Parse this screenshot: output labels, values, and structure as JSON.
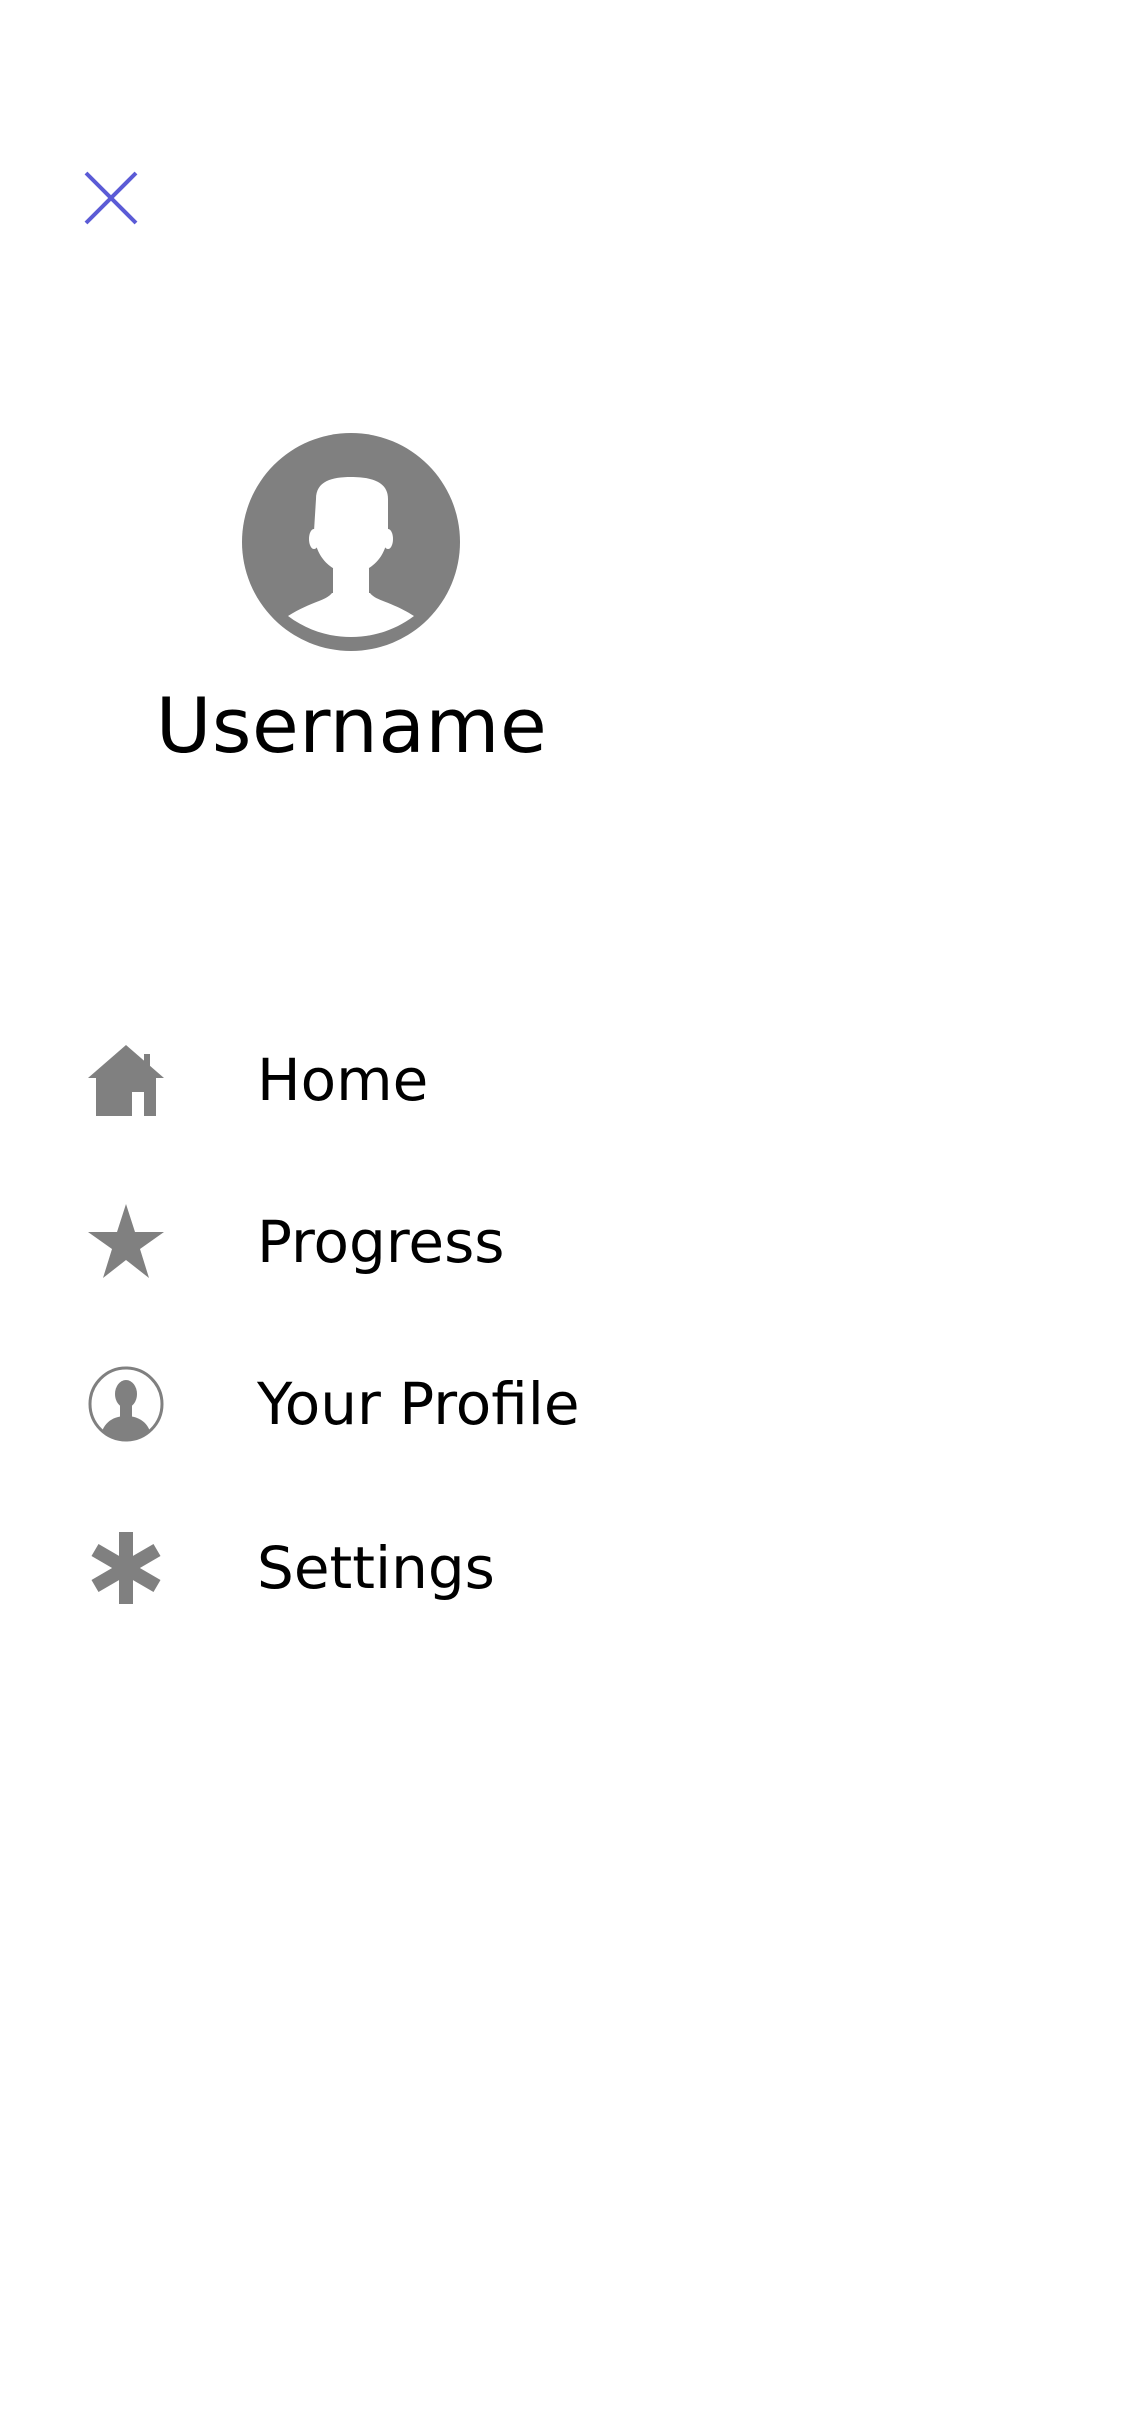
{
  "colors": {
    "accent": "#5b5bd6",
    "icon_gray": "#808080",
    "text": "#000000",
    "background": "#ffffff"
  },
  "header": {
    "close_icon": "close-icon"
  },
  "profile": {
    "avatar_icon": "user-silhouette-icon",
    "username": "Username"
  },
  "menu": {
    "items": [
      {
        "icon": "home-icon",
        "label": "Home"
      },
      {
        "icon": "star-icon",
        "label": "Progress"
      },
      {
        "icon": "profile-icon",
        "label": "Your Profile"
      },
      {
        "icon": "asterisk-icon",
        "label": "Settings"
      }
    ]
  }
}
